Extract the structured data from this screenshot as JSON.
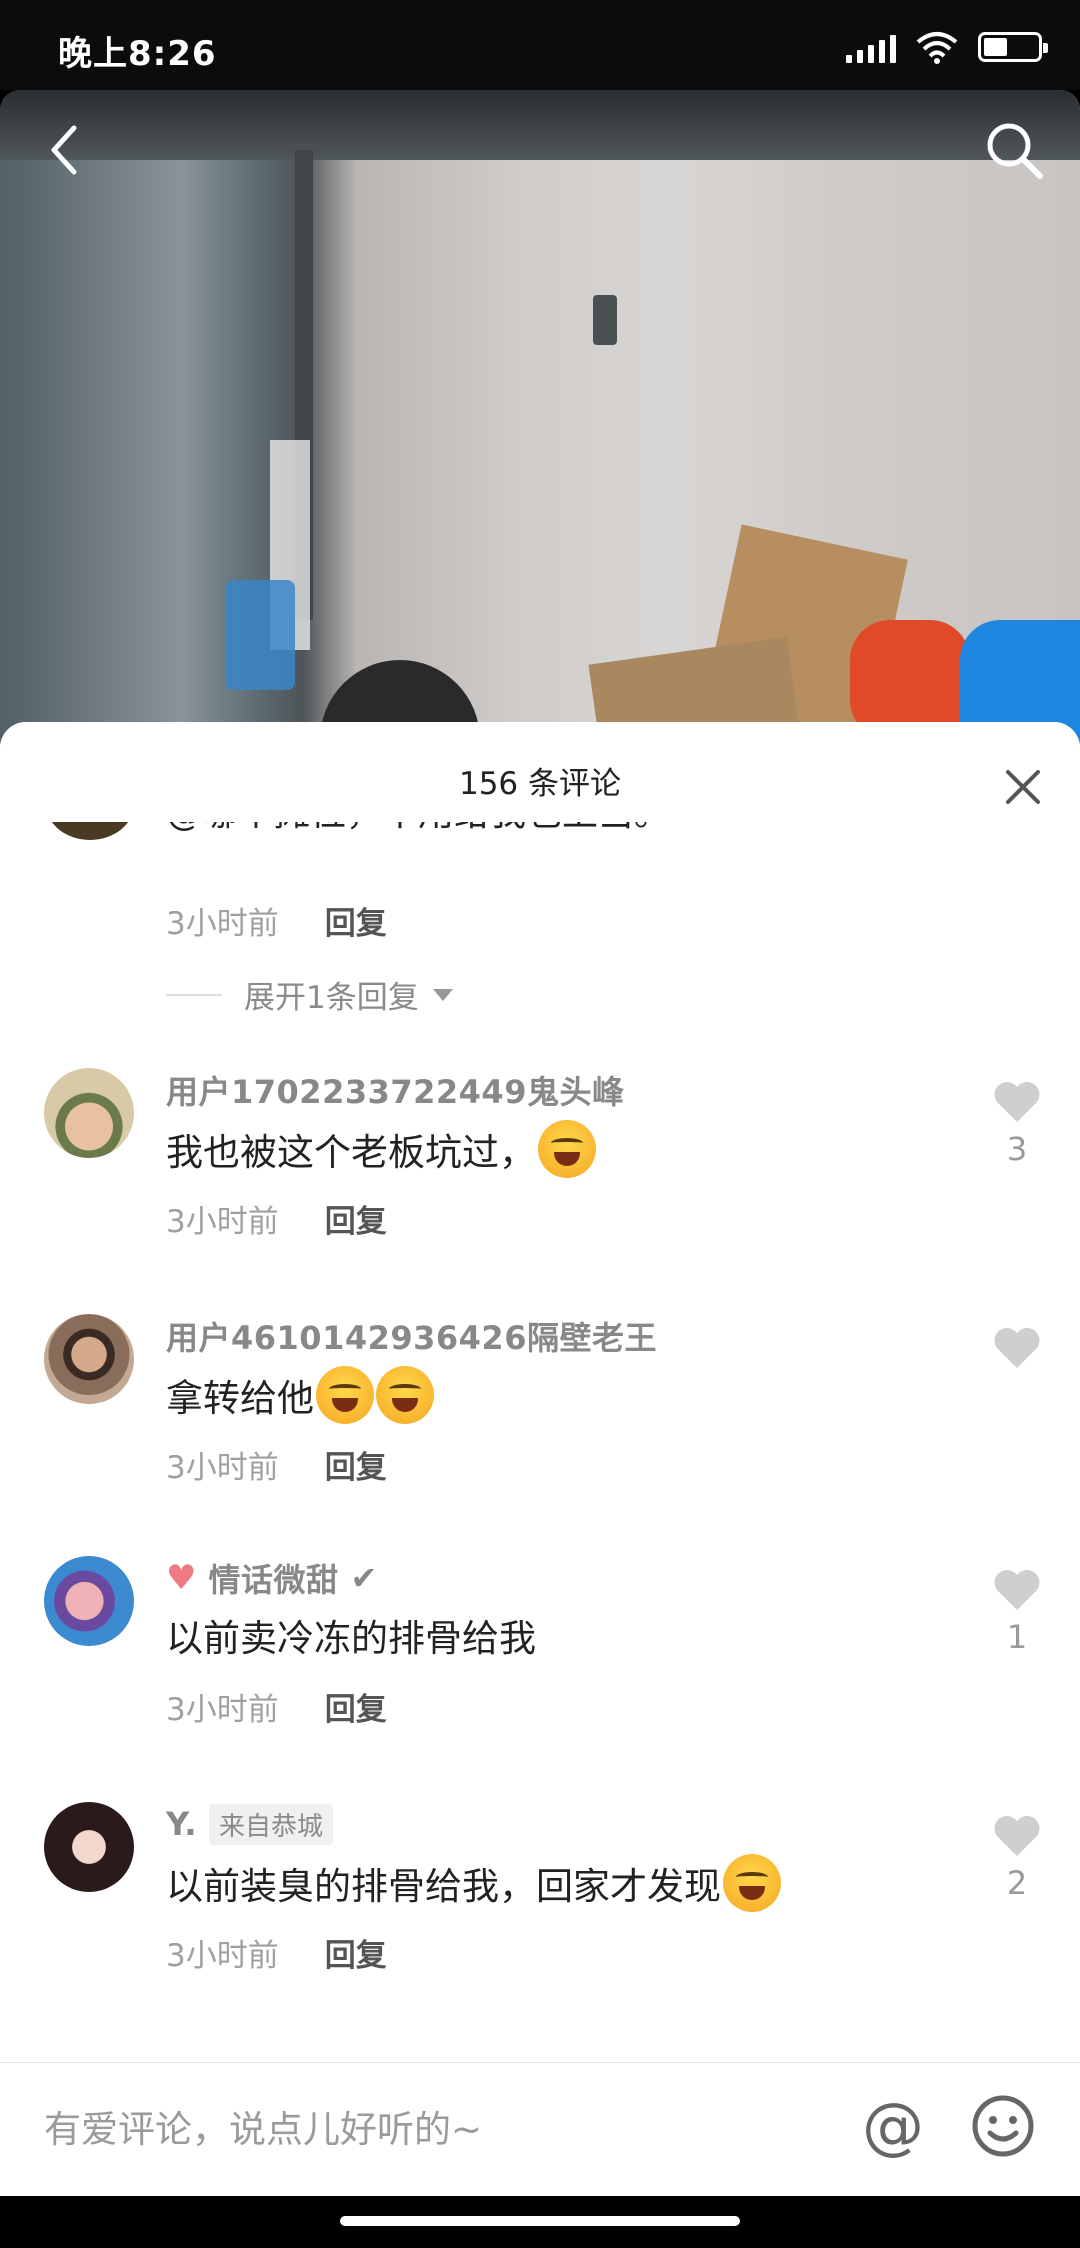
{
  "status_bar": {
    "time": "晚上8:26",
    "battery_level": 0.45
  },
  "header": {
    "back_icon": "back-arrow-icon",
    "search_icon": "search-icon"
  },
  "sheet": {
    "title": "156 条评论",
    "close_icon": "close-icon"
  },
  "partial_comment": {
    "text": "@哪个摊位，不用给我也上当。",
    "time": "3小时前",
    "reply": "回复"
  },
  "expand_replies": {
    "label": "展开1条回复"
  },
  "comments": [
    {
      "username": "用户1702233722449鬼头峰",
      "text": "我也被这个老板坑过，",
      "emoji": "crying-face-emoji",
      "time": "3小时前",
      "reply": "回复",
      "likes": "3"
    },
    {
      "username": "用户4610142936426隔壁老王",
      "text": "拿转给他",
      "emoji": "laughing-crying-emoji",
      "time": "3小时前",
      "reply": "回复",
      "likes": ""
    },
    {
      "username": "情话微甜",
      "username_prefix_icon": "heart-emoji",
      "username_suffix_icon": "checkmark-icon",
      "text": "以前卖冷冻的排骨给我",
      "time": "3小时前",
      "reply": "回复",
      "likes": "1"
    },
    {
      "username": "Y.",
      "location_tag": "来自恭城",
      "text": "以前装臭的排骨给我，回家才发现",
      "emoji": "laughing-crying-emoji",
      "time": "3小时前",
      "reply": "回复",
      "likes": "2"
    }
  ],
  "input_bar": {
    "placeholder": "有爱评论，说点儿好听的~",
    "at_label": "@",
    "emoji_icon": "smiley-face-icon"
  },
  "colors": {
    "like_gray": "#cfcfcf",
    "pink_heart": "#f07a84",
    "text_dark": "#222222",
    "text_gray": "#a0a0a0"
  }
}
